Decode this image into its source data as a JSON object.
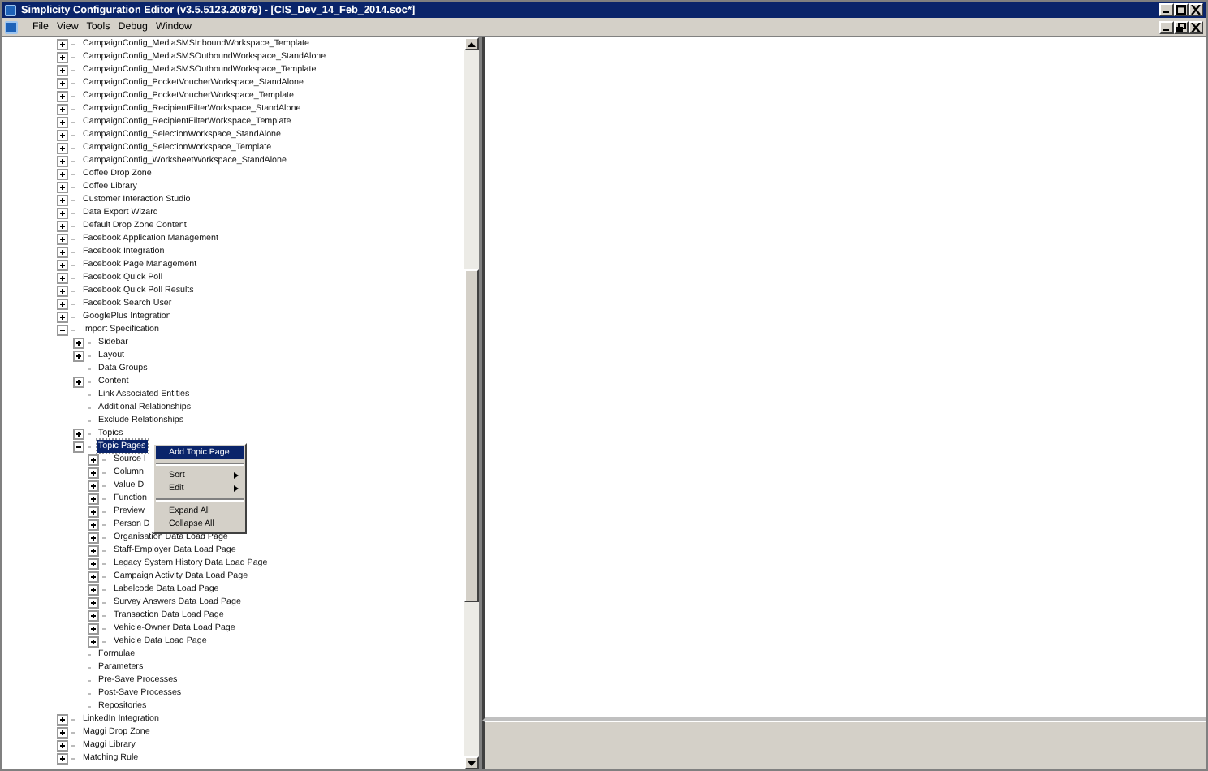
{
  "window": {
    "title": "Simplicity Configuration Editor (v3.5.5123.20879) - [CIS_Dev_14_Feb_2014.soc*]"
  },
  "menu_bar": [
    "File",
    "View",
    "Tools",
    "Debug",
    "Window"
  ],
  "tree": {
    "items": [
      {
        "label": "CampaignConfig_MediaSMSInboundWorkspace_Template",
        "kind": "folder",
        "expanded": false,
        "selected": false
      },
      {
        "label": "CampaignConfig_MediaSMSOutboundWorkspace_StandAlone",
        "kind": "folder",
        "expanded": false,
        "selected": false
      },
      {
        "label": "CampaignConfig_MediaSMSOutboundWorkspace_Template",
        "kind": "folder",
        "expanded": false,
        "selected": false
      },
      {
        "label": "CampaignConfig_PocketVoucherWorkspace_StandAlone",
        "kind": "folder",
        "expanded": false,
        "selected": false
      },
      {
        "label": "CampaignConfig_PocketVoucherWorkspace_Template",
        "kind": "folder",
        "expanded": false,
        "selected": false
      },
      {
        "label": "CampaignConfig_RecipientFilterWorkspace_StandAlone",
        "kind": "folder",
        "expanded": false,
        "selected": false
      },
      {
        "label": "CampaignConfig_RecipientFilterWorkspace_Template",
        "kind": "folder",
        "expanded": false,
        "selected": false
      },
      {
        "label": "CampaignConfig_SelectionWorkspace_StandAlone",
        "kind": "folder",
        "expanded": false,
        "selected": false
      },
      {
        "label": "CampaignConfig_SelectionWorkspace_Template",
        "kind": "folder",
        "expanded": false,
        "selected": false
      },
      {
        "label": "CampaignConfig_WorksheetWorkspace_StandAlone",
        "kind": "folder",
        "expanded": false,
        "selected": false
      },
      {
        "label": "Coffee Drop Zone",
        "kind": "folder",
        "expanded": false,
        "selected": false
      },
      {
        "label": "Coffee Library",
        "kind": "folder",
        "expanded": false,
        "selected": false
      },
      {
        "label": "Customer Interaction Studio",
        "kind": "folder",
        "expanded": false,
        "selected": false
      },
      {
        "label": "Data Export Wizard",
        "kind": "folder",
        "expanded": false,
        "selected": false
      },
      {
        "label": "Default Drop Zone Content",
        "kind": "folder",
        "expanded": false,
        "selected": false
      },
      {
        "label": "Facebook Application Management",
        "kind": "folder",
        "expanded": false,
        "selected": false
      },
      {
        "label": "Facebook Integration",
        "kind": "folder",
        "expanded": false,
        "selected": false
      },
      {
        "label": "Facebook Page Management",
        "kind": "folder",
        "expanded": false,
        "selected": false
      },
      {
        "label": "Facebook Quick Poll",
        "kind": "folder",
        "expanded": false,
        "selected": false
      },
      {
        "label": "Facebook Quick Poll Results",
        "kind": "folder",
        "expanded": false,
        "selected": false
      },
      {
        "label": "Facebook Search User",
        "kind": "folder",
        "expanded": false,
        "selected": false
      },
      {
        "label": "GooglePlus Integration",
        "kind": "folder",
        "expanded": false,
        "selected": false
      },
      {
        "label": "Import Specification",
        "kind": "folder",
        "expanded": true,
        "selected": false,
        "children": [
          {
            "label": "Sidebar",
            "kind": "folder",
            "expanded": false,
            "selected": false
          },
          {
            "label": "Layout",
            "kind": "folder",
            "expanded": false,
            "selected": false
          },
          {
            "label": "Data Groups",
            "kind": "leaf",
            "expanded": false,
            "selected": false
          },
          {
            "label": "Content",
            "kind": "folder",
            "expanded": false,
            "selected": false
          },
          {
            "label": "Link Associated Entities",
            "kind": "leaf",
            "expanded": false,
            "selected": false
          },
          {
            "label": "Additional Relationships",
            "kind": "leaf",
            "expanded": false,
            "selected": false
          },
          {
            "label": "Exclude Relationships",
            "kind": "leaf",
            "expanded": false,
            "selected": false
          },
          {
            "label": "Topics",
            "kind": "folder",
            "expanded": false,
            "selected": false
          },
          {
            "label": "Topic Pages",
            "kind": "folder",
            "expanded": true,
            "selected": true,
            "children": [
              {
                "label": "Source I",
                "kind": "folder",
                "expanded": false,
                "selected": false
              },
              {
                "label": "Column",
                "kind": "folder",
                "expanded": false,
                "selected": false
              },
              {
                "label": "Value D",
                "kind": "folder",
                "expanded": false,
                "selected": false
              },
              {
                "label": "Function",
                "kind": "folder",
                "expanded": false,
                "selected": false
              },
              {
                "label": "Preview",
                "kind": "folder",
                "expanded": false,
                "selected": false
              },
              {
                "label": "Person D",
                "kind": "folder",
                "expanded": false,
                "selected": false
              },
              {
                "label": "Organisation Data Load Page",
                "kind": "folder",
                "expanded": false,
                "selected": false
              },
              {
                "label": "Staff-Employer Data Load Page",
                "kind": "folder",
                "expanded": false,
                "selected": false
              },
              {
                "label": "Legacy System History Data Load Page",
                "kind": "folder",
                "expanded": false,
                "selected": false
              },
              {
                "label": "Campaign Activity Data Load Page",
                "kind": "folder",
                "expanded": false,
                "selected": false
              },
              {
                "label": "Labelcode Data Load Page",
                "kind": "folder",
                "expanded": false,
                "selected": false
              },
              {
                "label": "Survey Answers Data Load Page",
                "kind": "folder",
                "expanded": false,
                "selected": false
              },
              {
                "label": "Transaction Data Load Page",
                "kind": "folder",
                "expanded": false,
                "selected": false
              },
              {
                "label": "Vehicle-Owner Data Load Page",
                "kind": "folder",
                "expanded": false,
                "selected": false
              },
              {
                "label": "Vehicle Data Load Page",
                "kind": "folder",
                "expanded": false,
                "selected": false
              }
            ]
          },
          {
            "label": "Formulae",
            "kind": "leaf",
            "expanded": false,
            "selected": false
          },
          {
            "label": "Parameters",
            "kind": "leaf",
            "expanded": false,
            "selected": false
          },
          {
            "label": "Pre-Save Processes",
            "kind": "leaf",
            "expanded": false,
            "selected": false
          },
          {
            "label": "Post-Save Processes",
            "kind": "leaf",
            "expanded": false,
            "selected": false
          },
          {
            "label": "Repositories",
            "kind": "leaf",
            "expanded": false,
            "selected": false
          }
        ]
      },
      {
        "label": "LinkedIn Integration",
        "kind": "folder",
        "expanded": false,
        "selected": false
      },
      {
        "label": "Maggi Drop Zone",
        "kind": "folder",
        "expanded": false,
        "selected": false
      },
      {
        "label": "Maggi Library",
        "kind": "folder",
        "expanded": false,
        "selected": false
      },
      {
        "label": "Matching Rule",
        "kind": "folder",
        "expanded": false,
        "selected": false
      }
    ]
  },
  "context_menu": {
    "items": [
      {
        "kind": "item",
        "label": "Add Topic Page",
        "selected": true,
        "submenu": false
      },
      {
        "kind": "separator"
      },
      {
        "kind": "item",
        "label": "Sort",
        "selected": false,
        "submenu": true
      },
      {
        "kind": "item",
        "label": "Edit",
        "selected": false,
        "submenu": true
      },
      {
        "kind": "separator"
      },
      {
        "kind": "item",
        "label": "Expand All",
        "selected": false,
        "submenu": false
      },
      {
        "kind": "item",
        "label": "Collapse All",
        "selected": false,
        "submenu": false
      }
    ]
  }
}
